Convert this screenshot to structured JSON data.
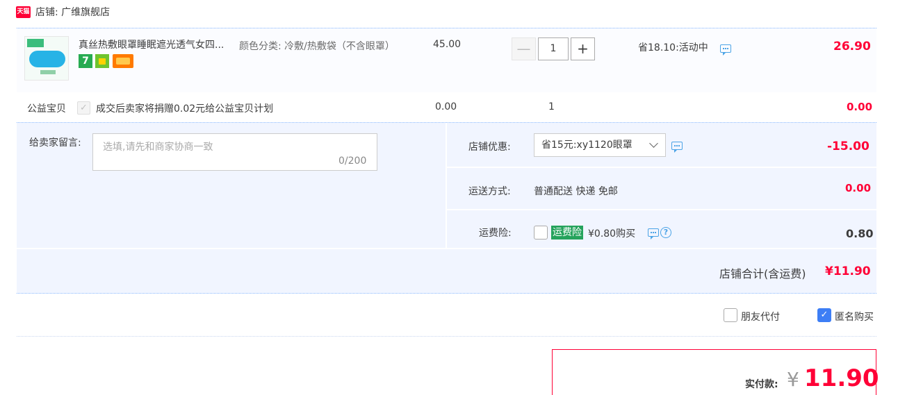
{
  "shop": {
    "logo_text": "天猫",
    "name": "店铺: 广维旗舰店"
  },
  "item": {
    "title": "真丝热敷眼罩睡眠遮光透气女四...",
    "sku": "颜色分类: 冷敷/热敷袋（不含眼罩）",
    "unit_price": "45.00",
    "quantity": "1",
    "minus_glyph": "—",
    "plus_glyph": "+",
    "promo": "省18.10:活动中",
    "subtotal": "26.90"
  },
  "charity": {
    "label": "公益宝贝",
    "checkmark": "✓",
    "text": "成交后卖家将捐赠0.02元给公益宝贝计划",
    "price": "0.00",
    "quantity": "1",
    "subtotal": "0.00"
  },
  "message": {
    "label": "给卖家留言:",
    "placeholder": "选填,请先和商家协商一致",
    "counter": "0/200"
  },
  "discount": {
    "label": "店铺优惠:",
    "selected": "省15元:xy1120眼罩",
    "value": "-15.00"
  },
  "shipping": {
    "label": "运送方式:",
    "method": "普通配送 快递 免邮",
    "value": "0.00"
  },
  "insurance": {
    "label": "运费险:",
    "tag": "运费险",
    "price": "¥0.80购买",
    "help_glyph": "?",
    "value": "0.80"
  },
  "shop_total": {
    "label": "店铺合计(含运费)",
    "value": "¥11.90"
  },
  "options": {
    "friend_pay": "朋友代付",
    "anonymous": "匿名购买",
    "checkmark": "✓"
  },
  "payment": {
    "label": "实付款:",
    "currency": "¥",
    "value": "11.90"
  },
  "colors": {
    "accent_red": "#ff0036",
    "link_blue": "#4ba3e6",
    "panel_bg": "#f1f5ff",
    "checkbox_blue": "#3d7ef5"
  }
}
